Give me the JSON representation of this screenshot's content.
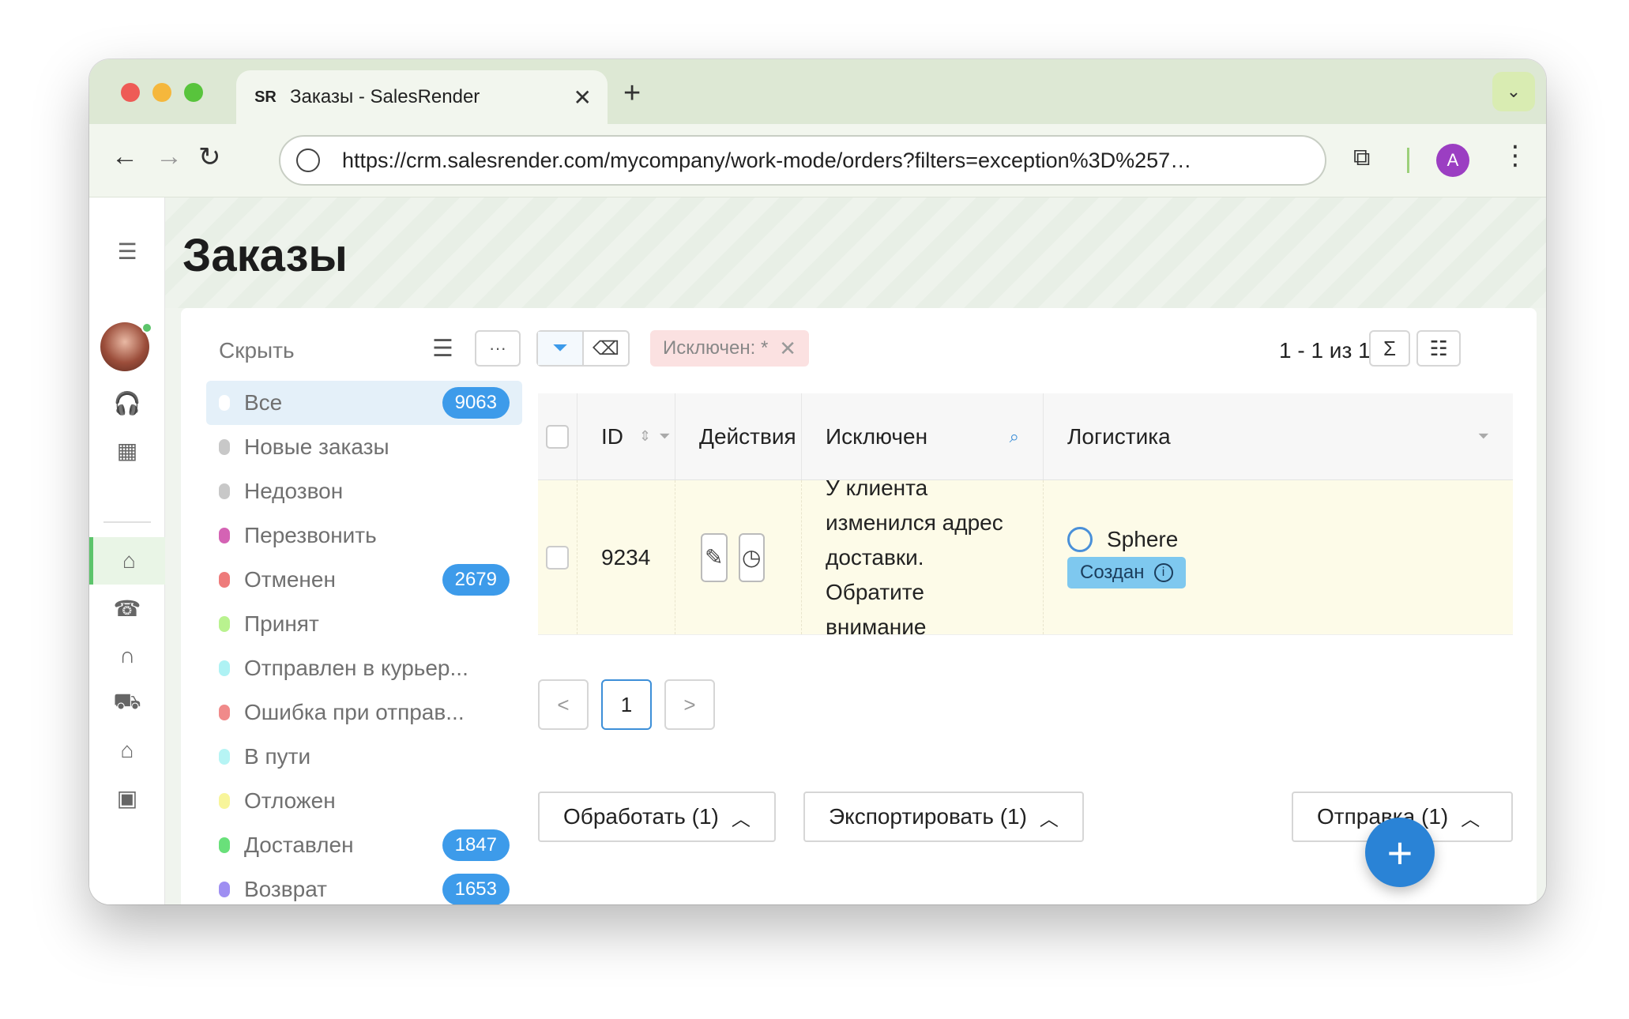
{
  "browser": {
    "tab_favicon": "SR",
    "tab_title": "Заказы - SalesRender",
    "url": "https://crm.salesrender.com/mycompany/work-mode/orders?filters=exception%3D%257…",
    "profile_initial": "A"
  },
  "page": {
    "title": "Заказы"
  },
  "status_panel": {
    "hide_label": "Скрыть",
    "items": [
      {
        "label": "Все",
        "color": "#ffffff",
        "count": "9063"
      },
      {
        "label": "Новые заказы",
        "color": "#c8c8c8",
        "count": null
      },
      {
        "label": "Недозвон",
        "color": "#c8c8c8",
        "count": null
      },
      {
        "label": "Перезвонить",
        "color": "#d463b4",
        "count": null
      },
      {
        "label": "Отменен",
        "color": "#ee7b7b",
        "count": "2679"
      },
      {
        "label": "Принят",
        "color": "#b9f28f",
        "count": null
      },
      {
        "label": "Отправлен в курьер...",
        "color": "#aef2f4",
        "count": null
      },
      {
        "label": "Ошибка при отправ...",
        "color": "#f08a8a",
        "count": null
      },
      {
        "label": "В пути",
        "color": "#b6f4f4",
        "count": null
      },
      {
        "label": "Отложен",
        "color": "#f8f59a",
        "count": null
      },
      {
        "label": "Доставлен",
        "color": "#69e07a",
        "count": "1847"
      },
      {
        "label": "Возврат",
        "color": "#9f8ff2",
        "count": "1653"
      }
    ]
  },
  "toolbar": {
    "filter_chip": "Исключен: *",
    "paging": "1 - 1 из 1"
  },
  "table": {
    "columns": [
      "ID",
      "Действия",
      "Исключен",
      "Логистика"
    ],
    "rows": [
      {
        "id": "9234",
        "exception": "У клиента изменился адрес доставки. Обратите внимание",
        "logistics_name": "Sphere",
        "logistics_status": "Создан"
      }
    ]
  },
  "pagination": {
    "prev": "<",
    "current": "1",
    "next": ">"
  },
  "actions": {
    "process": "Обработать (1)",
    "export": "Экспортировать (1)",
    "send": "Отправка (1)"
  }
}
